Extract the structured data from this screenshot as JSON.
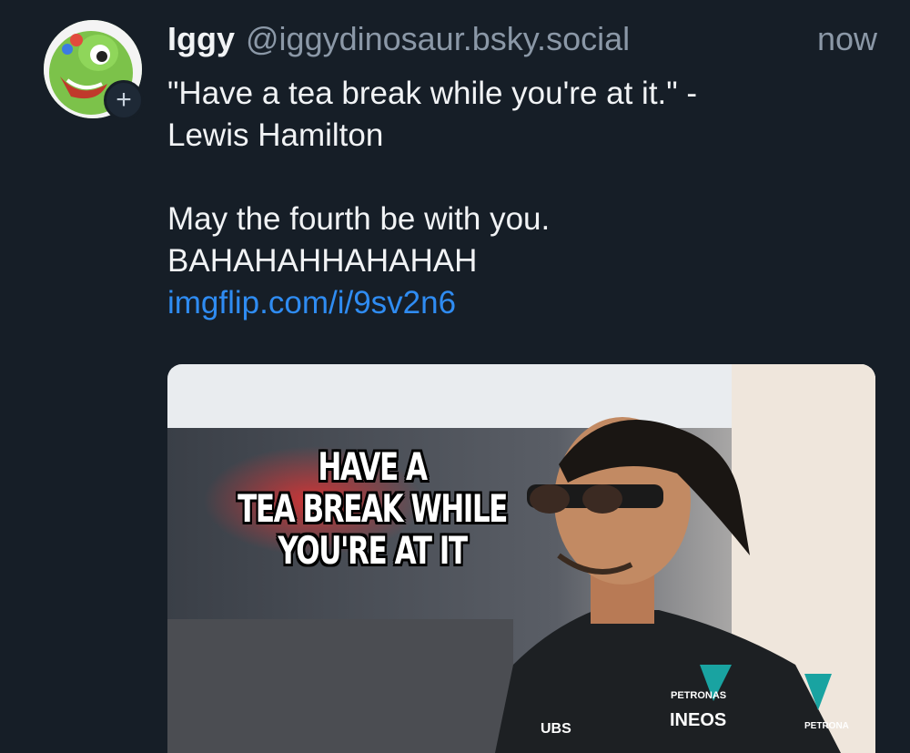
{
  "post": {
    "author_name": "Iggy",
    "author_handle": "@iggydinosaur.bsky.social",
    "timestamp": "now",
    "text_line1": "\"Have a tea break while you're at it.\" -\nLewis Hamilton",
    "text_line2": "May the fourth be with you.\nBAHAHAHHAHAHAH",
    "link": "imgflip.com/i/9sv2n6"
  },
  "avatar": {
    "icon": "dinosaur-avatar",
    "badge": "+"
  },
  "meme": {
    "lines": [
      "HAVE A",
      "TEA BREAK WHILE",
      "YOU'RE AT IT"
    ],
    "jacket_labels": [
      "PETRONAS",
      "INEOS",
      "UBS",
      "PETRONA"
    ]
  },
  "colors": {
    "background": "#161e27",
    "link": "#2f8cf2",
    "muted": "#8b98a7"
  }
}
